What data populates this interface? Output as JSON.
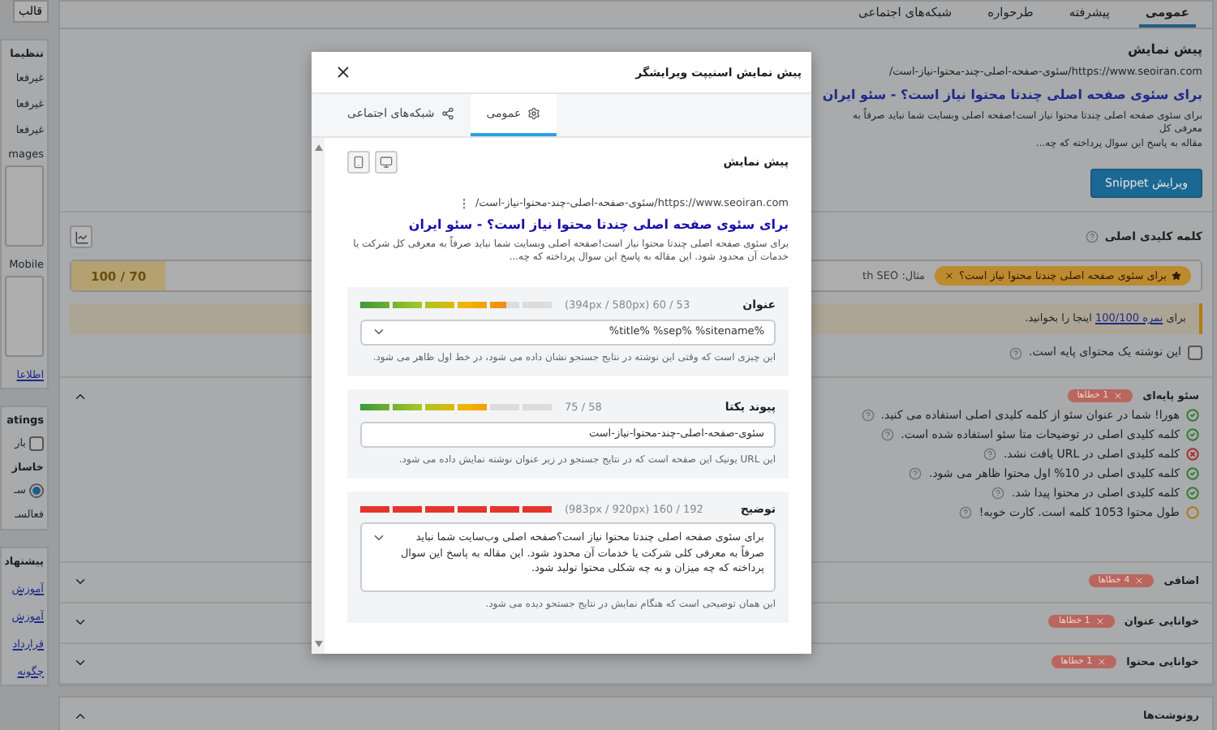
{
  "sidebar": {
    "template_button": "قالب",
    "settings": {
      "title": "تنظیما",
      "options": [
        "غیرفعا",
        "غیرفعا",
        "غیرفعا"
      ],
      "fields": [
        "mages",
        "Mobile"
      ],
      "link": "اطلاعا"
    },
    "ratings": {
      "title": "atings",
      "checkbox": {
        "label": "بار",
        "checked": false
      },
      "group_label": "خاساز",
      "radio": {
        "label": "سـ",
        "selected": true
      },
      "note": "فعالسـ"
    },
    "suggestions": {
      "title": "پیشنهاد",
      "links": [
        "آموزش",
        "آموزش",
        "قرارداد",
        "چگونه"
      ]
    }
  },
  "editor_tabs": [
    {
      "label": "عمومی",
      "selected": true
    },
    {
      "label": "پیشرفته",
      "selected": false
    },
    {
      "label": "طرحواره",
      "selected": false
    },
    {
      "label": "شبکه‌های اجتماعی",
      "selected": false
    }
  ],
  "preview": {
    "title": "پیش نمایش",
    "url": "https://www.seoiran.com/سئوی-صفحه-اصلی-چند-محتوا-نیاز-است/",
    "seo_title": "برای سئوی صفحه اصلی چندتا محتوا نیاز است؟ - سئو ایران",
    "description_lines": [
      "برای سئوی صفحه اصلی چندتا محتوا نیاز است!صفحه اصلی وبسایت شما نباید صرفاً به معرفی کل",
      "مقاله به پاسخ این سوال پرداخته که چه..."
    ],
    "edit_button": "ویرایش Snippet"
  },
  "focus_keyword": {
    "label": "کلمه کلیدی اصلی",
    "score": "100 / 70",
    "placeholder": "مثال: th SEO",
    "keyword_tag": "برای سئوی صفحه اصلی چندتا محتوا نیاز است؟"
  },
  "notice": {
    "before": "برای",
    "link": "نمره 100/100",
    "after": "اینجا را بخوانید."
  },
  "pillar": {
    "label": "این نوشته یک محتوای پایه است.",
    "checked": false
  },
  "analysis_sections": [
    {
      "title": "سئو پایه‌ای",
      "badge": "1 خطاها",
      "expanded": true,
      "checks": [
        {
          "kind": "pass",
          "text": "هورا! شما در عنوان سئو از کلمه کلیدی اصلی استفاده می کنید."
        },
        {
          "kind": "pass",
          "text": "کلمه کلیدی اصلی در توضیحات متا سئو استفاده شده است."
        },
        {
          "kind": "fail",
          "text": "کلمه کلیدی اصلی در URL یافت نشد."
        },
        {
          "kind": "pass",
          "text": "کلمه کلیدی اصلی در 10% اول محتوا ظاهر می شود."
        },
        {
          "kind": "pass",
          "text": "کلمه کلیدی اصلی در محتوا پیدا شد."
        },
        {
          "kind": "warn",
          "text": "طول محتوا 1053 کلمه است. کارت خوبه!"
        }
      ]
    },
    {
      "title": "اضافی",
      "badge": "4 خطاها",
      "expanded": false
    },
    {
      "title": "خوانایی عنوان",
      "badge": "1 خطاها",
      "expanded": false
    },
    {
      "title": "خوانایی محتوا",
      "badge": "1 خطاها",
      "expanded": false
    }
  ],
  "transcripts_panel": {
    "title": "رونوشت‌ها",
    "expanded": true
  },
  "modal": {
    "title": "پیش نمایش اسنیپت ویرایشگر",
    "tabs": [
      {
        "label": "عمومی",
        "selected": true
      },
      {
        "label": "شبکه‌های اجتماعی",
        "selected": false
      }
    ],
    "preview_title": "پیش نمایش",
    "snippet": {
      "url": "https://www.seoiran.com/سئوی-صفحه-اصلی-چند-محتوا-نیاز-است/",
      "title": "برای سئوی صفحه اصلی چندتا محتوا نیاز است؟ - سئو ایران",
      "description": "برای سئوی صفحه اصلی چندتا محتوا نیاز است!صفحه اصلی وبسایت شما نباید صرفاً به معرفی کل شرکت یا خدمات آن محدود شود. این مقاله به پاسخ این سوال پرداخته که چه..."
    },
    "fields": [
      {
        "label": "عنوان",
        "kind": "input",
        "value": "%title% %sep% %sitename%",
        "has_variables": true,
        "reading": "(394px / 580px) 60 / 53",
        "level": 0.75,
        "over": false,
        "help": "این چیزی است که وقتی این نوشته در نتایج جستجو نشان داده می شود، در خط اول ظاهر می شود."
      },
      {
        "label": "پیوند یکتا",
        "kind": "input",
        "value": "سئوی-صفحه-اصلی-چند-محتوا-نیاز-است",
        "has_variables": false,
        "reading": "75 / 58",
        "level": 0.65,
        "over": false,
        "help": "این URL یونیک این صفحه است که در نتایج جستجو در زیر عنوان نوشته نمایش داده می شود."
      },
      {
        "label": "توضیح",
        "kind": "textarea",
        "value": "برای سئوی صفحه اصلی چندتا محتوا نیاز است؟صفحه اصلی وب‌سایت شما نباید صرفاً به معرفی کلی شرکت یا خدمات آن محدود شود. این مقاله به پاسخ این سوال پرداخته که چه میزان و به چه شکلی محتوا تولید شود.",
        "has_variables": true,
        "reading": "(983px / 920px) 160 / 192",
        "level": 1,
        "over": true,
        "help": "این همان توضیحی است که هنگام نمایش در نتایج جستجو دیده می شود."
      }
    ]
  }
}
